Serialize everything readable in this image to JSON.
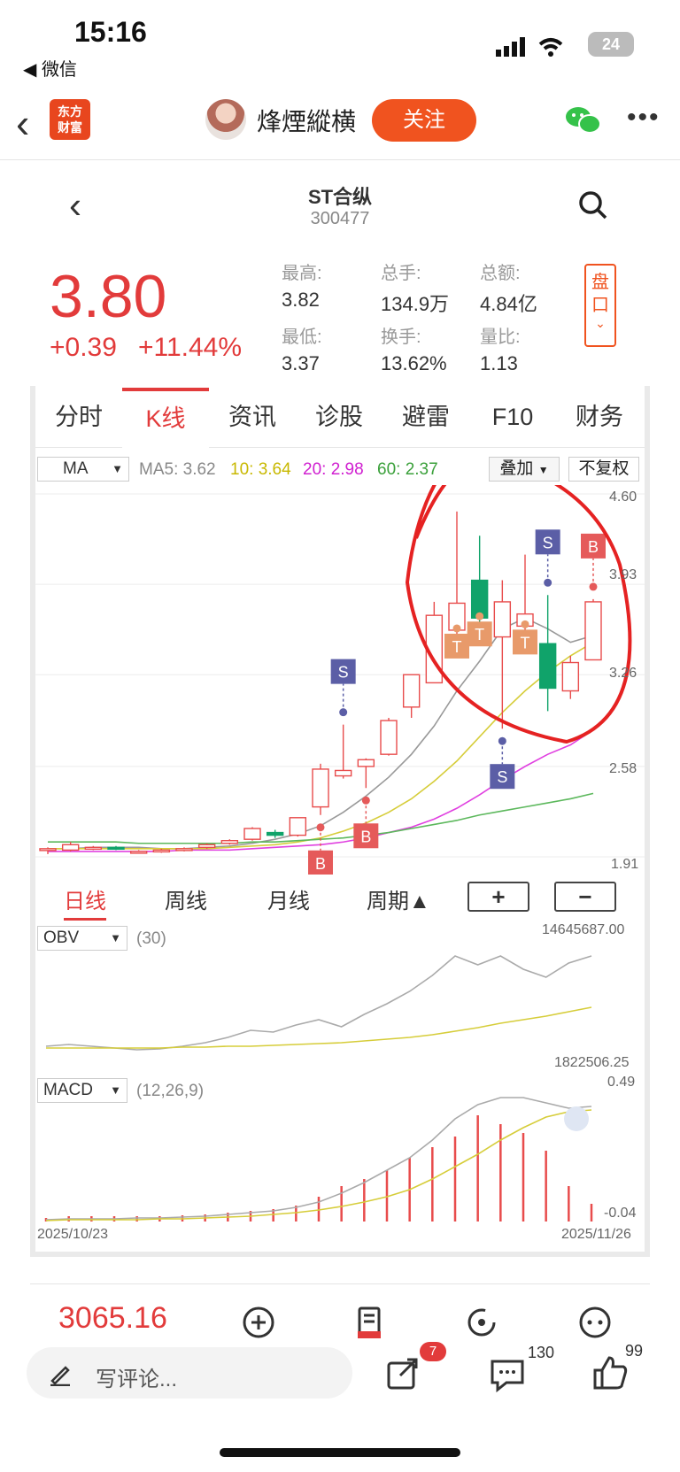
{
  "status_bar": {
    "time": "15:16",
    "back_app": "◀ 微信",
    "battery": "24"
  },
  "article_header": {
    "logo_text": "东方\n财富",
    "author": "烽煙縱横",
    "follow_label": "关注"
  },
  "stock": {
    "name": "ST合纵",
    "code": "300477",
    "price": "3.80",
    "change": "+0.39",
    "change_pct": "+11.44%",
    "stats": [
      {
        "label": "最高:",
        "value": "3.82"
      },
      {
        "label": "总手:",
        "value": "134.9万"
      },
      {
        "label": "总额:",
        "value": "4.84亿"
      },
      {
        "label": "最低:",
        "value": "3.37"
      },
      {
        "label": "换手:",
        "value": "13.62%"
      },
      {
        "label": "量比:",
        "value": "1.13"
      }
    ],
    "pankou_label": "盘口"
  },
  "tabs": [
    "分时",
    "K线",
    "资讯",
    "诊股",
    "避雷",
    "F10",
    "财务"
  ],
  "active_tab": "K线",
  "kline": {
    "indicator": "MA",
    "ma_values": {
      "ma5": "MA5: 3.62",
      "ma10": "10: 3.64",
      "ma20": "20: 2.98",
      "ma60": "60: 2.37"
    },
    "overlay_label": "叠加",
    "fq_label": "不复权",
    "price_axis": [
      "4.60",
      "3.93",
      "3.26",
      "2.58",
      "1.91"
    ]
  },
  "chart_data": {
    "type": "candlestick",
    "start_date": "2025/10/23",
    "end_date": "2025/11/26",
    "ylim": [
      1.91,
      4.6
    ],
    "candles": [
      {
        "o": 1.96,
        "h": 1.98,
        "l": 1.93,
        "c": 1.97
      },
      {
        "o": 1.96,
        "h": 2.02,
        "l": 1.95,
        "c": 2.0
      },
      {
        "o": 1.98,
        "h": 1.99,
        "l": 1.96,
        "c": 1.98
      },
      {
        "o": 1.98,
        "h": 1.99,
        "l": 1.96,
        "c": 1.97
      },
      {
        "o": 1.95,
        "h": 1.96,
        "l": 1.94,
        "c": 1.95
      },
      {
        "o": 1.95,
        "h": 1.97,
        "l": 1.94,
        "c": 1.96
      },
      {
        "o": 1.96,
        "h": 1.98,
        "l": 1.95,
        "c": 1.97
      },
      {
        "o": 1.98,
        "h": 2.01,
        "l": 1.97,
        "c": 2.0
      },
      {
        "o": 2.01,
        "h": 2.04,
        "l": 2.0,
        "c": 2.03
      },
      {
        "o": 2.04,
        "h": 2.13,
        "l": 2.03,
        "c": 2.12
      },
      {
        "o": 2.09,
        "h": 2.11,
        "l": 2.05,
        "c": 2.07
      },
      {
        "o": 2.07,
        "h": 2.2,
        "l": 2.06,
        "c": 2.2
      },
      {
        "o": 2.28,
        "h": 2.6,
        "l": 2.22,
        "c": 2.56
      },
      {
        "o": 2.51,
        "h": 2.89,
        "l": 2.49,
        "c": 2.55
      },
      {
        "o": 2.58,
        "h": 2.64,
        "l": 2.42,
        "c": 2.63
      },
      {
        "o": 2.67,
        "h": 2.94,
        "l": 2.66,
        "c": 2.92
      },
      {
        "o": 3.02,
        "h": 3.26,
        "l": 2.94,
        "c": 3.26
      },
      {
        "o": 3.2,
        "h": 3.8,
        "l": 3.2,
        "c": 3.7
      },
      {
        "o": 3.59,
        "h": 4.47,
        "l": 3.48,
        "c": 3.79
      },
      {
        "o": 3.96,
        "h": 4.29,
        "l": 3.64,
        "c": 3.68
      },
      {
        "o": 3.54,
        "h": 3.96,
        "l": 2.86,
        "c": 3.8
      },
      {
        "o": 3.62,
        "h": 4.15,
        "l": 3.42,
        "c": 3.71
      },
      {
        "o": 3.49,
        "h": 3.85,
        "l": 2.99,
        "c": 3.16
      },
      {
        "o": 3.14,
        "h": 3.4,
        "l": 3.08,
        "c": 3.35
      },
      {
        "o": 3.37,
        "h": 3.82,
        "l": 3.37,
        "c": 3.8
      }
    ],
    "ma_lines": [
      {
        "name": "MA5",
        "color": "#999999",
        "values": [
          1.97,
          1.97,
          1.98,
          1.98,
          1.98,
          1.97,
          1.97,
          1.98,
          1.99,
          2.01,
          2.04,
          2.08,
          2.14,
          2.24,
          2.36,
          2.5,
          2.67,
          2.88,
          3.14,
          3.36,
          3.6,
          3.68,
          3.6,
          3.5,
          3.55
        ]
      },
      {
        "name": "MA10",
        "color": "#d6cd3a",
        "values": [
          1.97,
          1.97,
          1.97,
          1.97,
          1.97,
          1.97,
          1.97,
          1.97,
          1.98,
          1.99,
          2.0,
          2.02,
          2.05,
          2.1,
          2.16,
          2.24,
          2.34,
          2.47,
          2.62,
          2.8,
          2.98,
          3.14,
          3.28,
          3.4,
          3.5
        ]
      },
      {
        "name": "MA20",
        "color": "#e040e0",
        "values": [
          1.95,
          1.95,
          1.95,
          1.95,
          1.95,
          1.95,
          1.96,
          1.96,
          1.96,
          1.97,
          1.98,
          1.99,
          2.0,
          2.02,
          2.05,
          2.09,
          2.13,
          2.19,
          2.27,
          2.37,
          2.48,
          2.58,
          2.67,
          2.74,
          2.85
        ]
      },
      {
        "name": "MA60",
        "color": "#5cb85c",
        "values": [
          2.02,
          2.02,
          2.02,
          2.02,
          2.01,
          2.01,
          2.01,
          2.01,
          2.01,
          2.02,
          2.02,
          2.03,
          2.04,
          2.05,
          2.07,
          2.09,
          2.12,
          2.15,
          2.18,
          2.22,
          2.25,
          2.28,
          2.31,
          2.34,
          2.38
        ]
      }
    ],
    "signals": [
      {
        "i": 13,
        "type": "S",
        "above": true
      },
      {
        "i": 12,
        "type": "B",
        "above": false
      },
      {
        "i": 14,
        "type": "B",
        "above": false
      },
      {
        "i": 18,
        "type": "T",
        "above": false
      },
      {
        "i": 19,
        "type": "T",
        "above": false
      },
      {
        "i": 20,
        "type": "S",
        "above": false
      },
      {
        "i": 21,
        "type": "T",
        "above": false
      },
      {
        "i": 22,
        "type": "S",
        "above": true
      },
      {
        "i": 24,
        "type": "B",
        "above": true
      }
    ],
    "obv": {
      "label": "OBV",
      "param": "(30)",
      "top": "14645687.00",
      "bottom": "1822506.25"
    },
    "macd": {
      "label": "MACD",
      "param": "(12,26,9)",
      "top": "0.49",
      "bottom": "-0.04"
    }
  },
  "period_tabs": [
    "日线",
    "周线",
    "月线",
    "周期▲"
  ],
  "zoom": {
    "plus": "+",
    "minus": "−"
  },
  "bottom": {
    "index_value": "3065.16",
    "comment_placeholder": "写评论...",
    "share_badge": "7",
    "comment_count": "130",
    "like_count": "99"
  }
}
